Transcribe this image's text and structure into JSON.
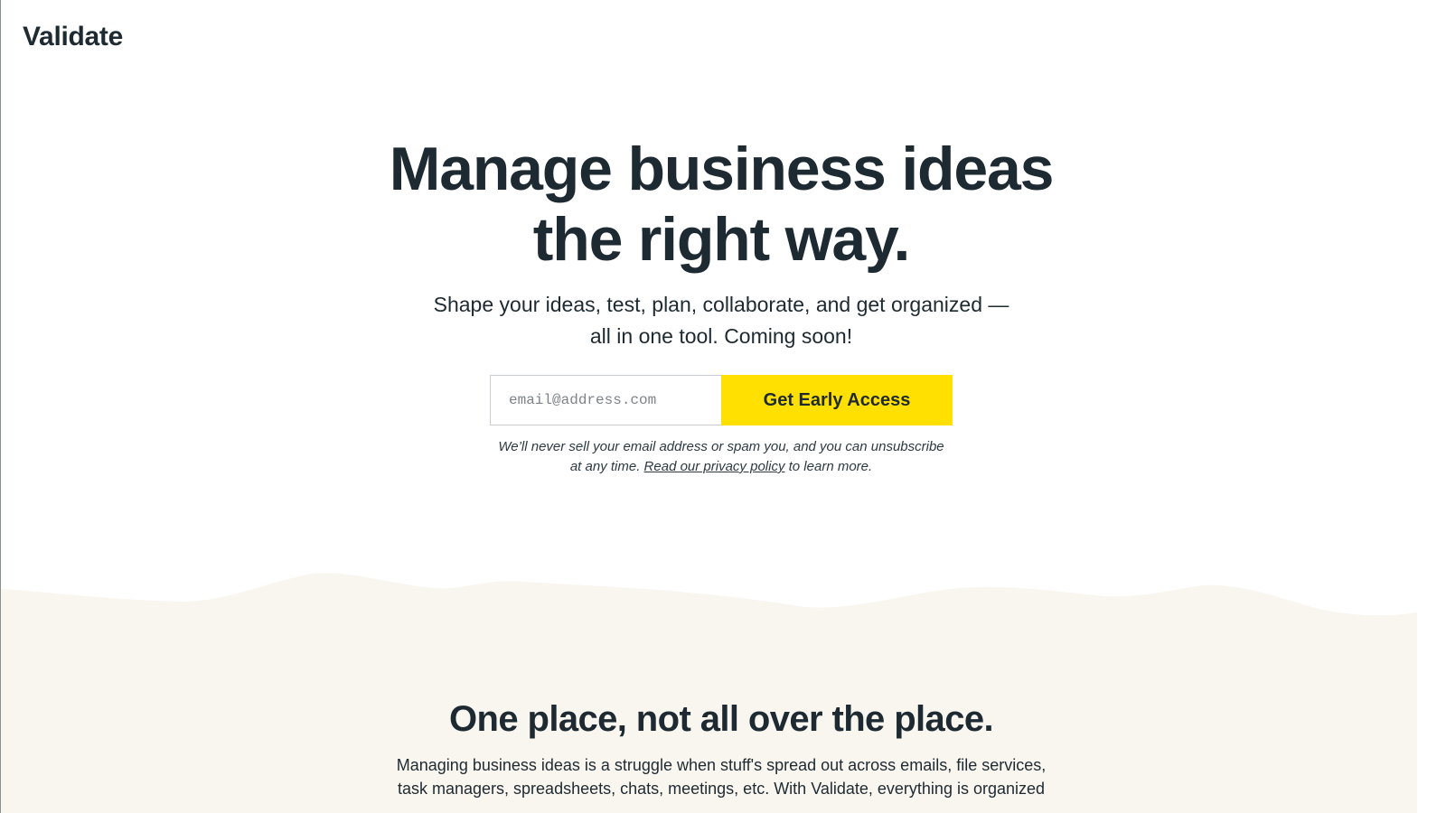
{
  "header": {
    "logo": "Validate"
  },
  "hero": {
    "title_line1": "Manage business ideas",
    "title_line2": "the right way.",
    "subtitle_line1": "Shape your ideas, test, plan, collaborate, and get organized —",
    "subtitle_line2": "all in one tool. Coming soon!"
  },
  "signup": {
    "email_placeholder": "email@address.com",
    "email_value": "",
    "button_label": "Get Early Access"
  },
  "disclaimer": {
    "line1": "We’ll never sell your email address or spam you, and you can unsubscribe",
    "line2_prefix": "at any time.",
    "link_text": "Read our privacy policy",
    "line2_suffix": "to learn more."
  },
  "section": {
    "title": "One place, not all over the place.",
    "body_line1": "Managing business ideas is a struggle when stuff's spread out across emails, file services,",
    "body_line2": "task managers, spreadsheets, chats, meetings, etc. With Validate, everything is organized"
  },
  "colors": {
    "text": "#1e2a32",
    "accent_button": "#ffe000",
    "section_background": "#f9f5ef"
  }
}
